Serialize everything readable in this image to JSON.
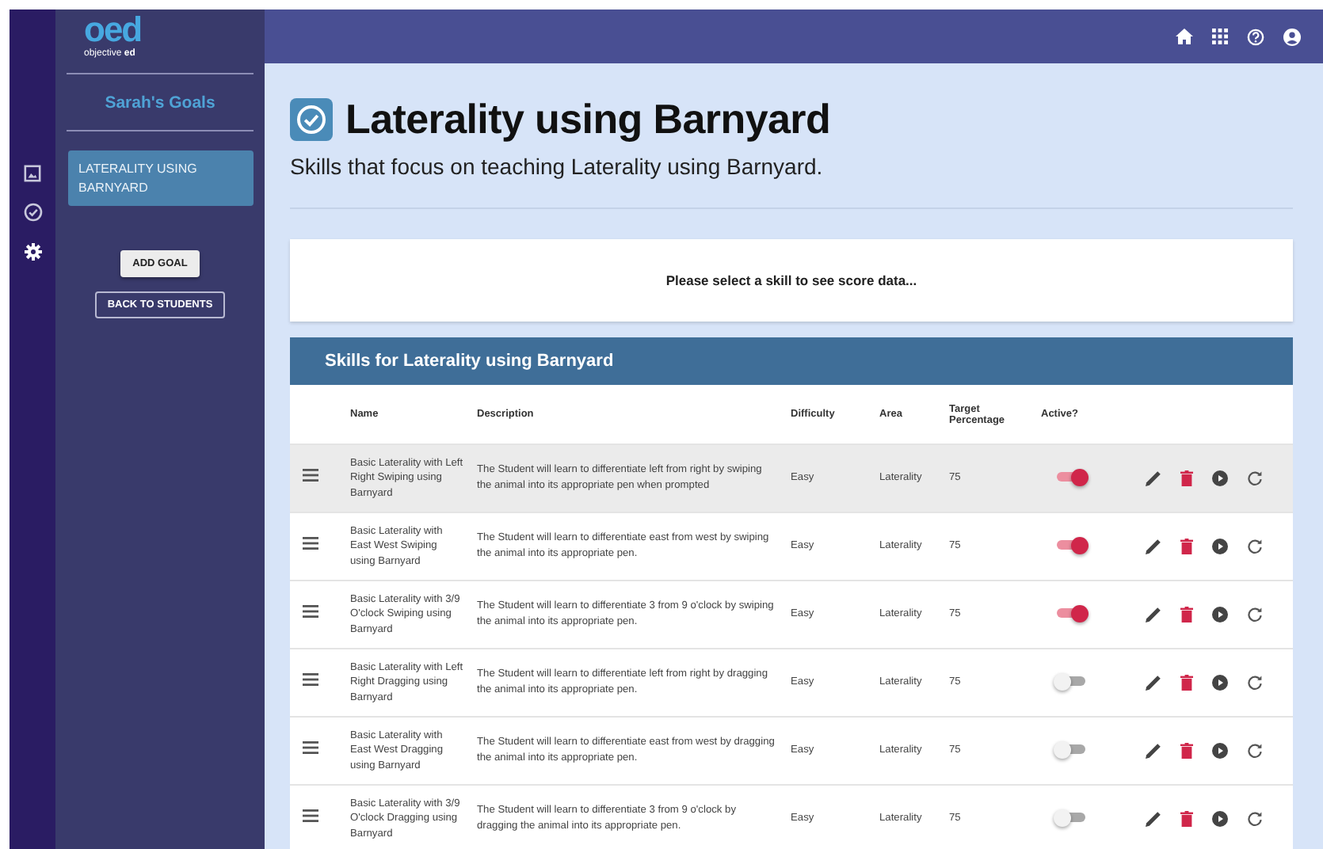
{
  "logo": {
    "mark": "oed",
    "tagline": "objective **ed**"
  },
  "rail": [
    {
      "kind": "image",
      "selected": false
    },
    {
      "kind": "check",
      "selected": false
    },
    {
      "kind": "gear",
      "selected": true
    }
  ],
  "sidebar": {
    "heading": "Sarah's Goals",
    "goals": [
      {
        "label": "LATERALITY USING BARNYARD",
        "selected": true
      }
    ],
    "add_button": "ADD GOAL",
    "back_button": "BACK TO STUDENTS"
  },
  "topbar": {
    "icons": [
      {
        "kind": "home"
      },
      {
        "kind": "apps"
      },
      {
        "kind": "help"
      },
      {
        "kind": "account"
      }
    ]
  },
  "page": {
    "title": "Laterality using Barnyard",
    "subtitle": "Skills that focus on teaching Laterality using Barnyard."
  },
  "score_card": {
    "message": "Please select a skill to see score data..."
  },
  "skills": {
    "title": "Skills for Laterality using Barnyard",
    "columns": [
      "Name",
      "Description",
      "Difficulty",
      "Area",
      "Target Percentage",
      "Active?"
    ],
    "rows": [
      {
        "name": "Basic Laterality with Left Right Swiping using Barnyard",
        "description": "The Student will learn to differentiate left from right by swiping the animal into its appropriate pen when prompted",
        "difficulty": "Easy",
        "area": "Laterality",
        "target": "75",
        "active": true,
        "selected": true
      },
      {
        "name": "Basic Laterality with East West Swiping using Barnyard",
        "description": "The Student will learn to differentiate east from west by swiping the animal into its appropriate pen.",
        "difficulty": "Easy",
        "area": "Laterality",
        "target": "75",
        "active": true,
        "selected": false
      },
      {
        "name": "Basic Laterality with 3/9 O'clock Swiping using Barnyard",
        "description": "The Student will learn to differentiate 3 from 9 o'clock by swiping the animal into its appropriate pen.",
        "difficulty": "Easy",
        "area": "Laterality",
        "target": "75",
        "active": true,
        "selected": false
      },
      {
        "name": "Basic Laterality with Left Right Dragging using Barnyard",
        "description": "The Student will learn to differentiate left from right by dragging the animal into its appropriate pen.",
        "difficulty": "Easy",
        "area": "Laterality",
        "target": "75",
        "active": false,
        "selected": false
      },
      {
        "name": "Basic Laterality with East West Dragging using Barnyard",
        "description": "The Student will learn to differentiate east from west by dragging the animal into its appropriate pen.",
        "difficulty": "Easy",
        "area": "Laterality",
        "target": "75",
        "active": false,
        "selected": false
      },
      {
        "name": "Basic Laterality with 3/9 O'clock Dragging using Barnyard",
        "description": "The Student will learn to differentiate 3 from 9 o'clock by dragging the animal into its appropriate pen.",
        "difficulty": "Easy",
        "area": "Laterality",
        "target": "75",
        "active": false,
        "selected": false
      }
    ]
  }
}
